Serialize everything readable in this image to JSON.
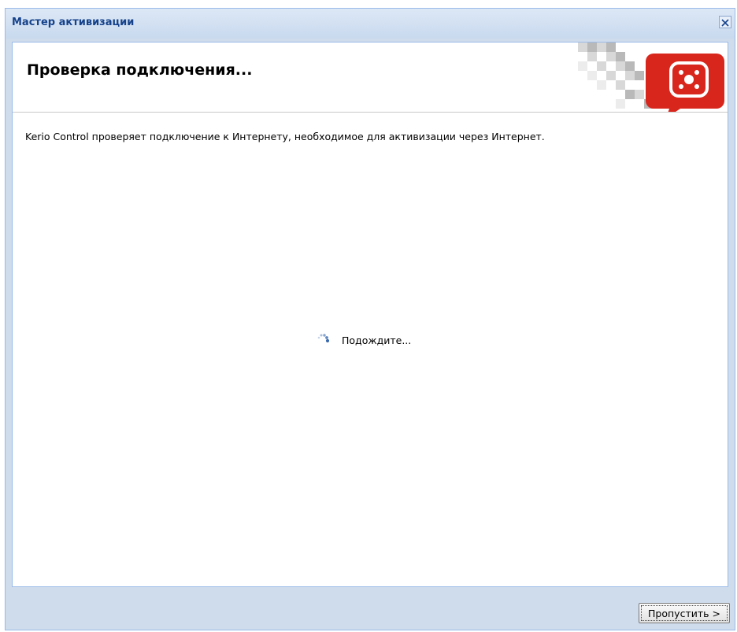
{
  "window": {
    "title": "Мастер активизации",
    "close_icon": "close-icon"
  },
  "header": {
    "title": "Проверка подключения...",
    "logo_icon": "kerio-logo-icon"
  },
  "content": {
    "message": "Kerio Control проверяет подключение к Интернету, необходимое для активизации через Интернет.",
    "loading_text": "Подождите...",
    "spinner_icon": "spinner-icon"
  },
  "footer": {
    "skip_label": "Пропустить >"
  },
  "colors": {
    "window_title": "#15428b",
    "window_bg": "#cfdcec",
    "border": "#99bbe8",
    "logo_accent": "#d9261c"
  }
}
